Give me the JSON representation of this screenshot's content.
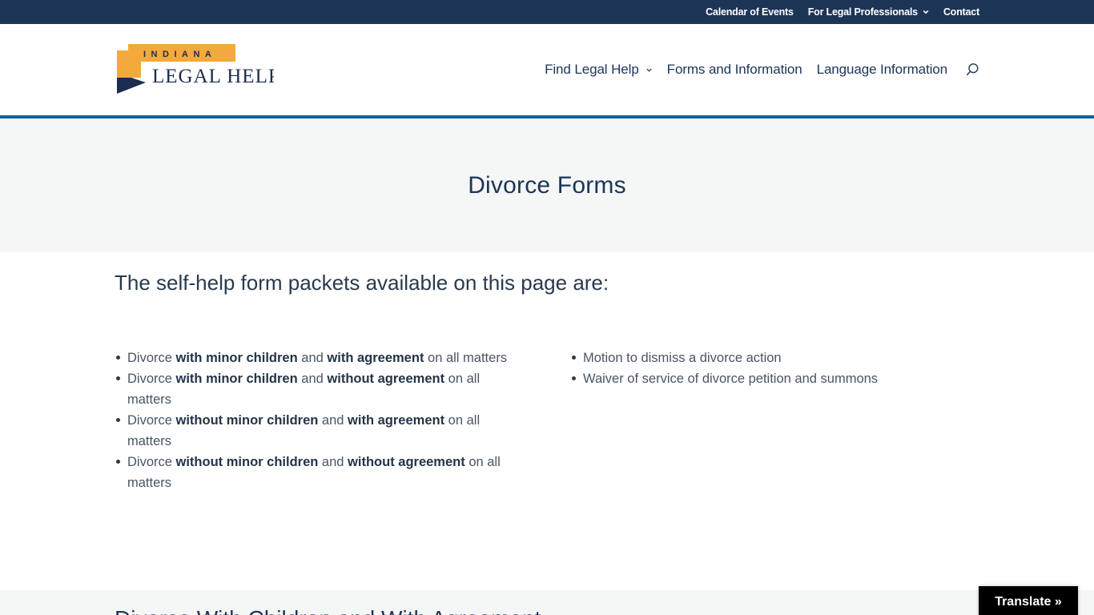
{
  "topbar": {
    "links": [
      {
        "label": "Calendar of Events",
        "has_dropdown": false
      },
      {
        "label": "For Legal Professionals",
        "has_dropdown": true
      },
      {
        "label": "Contact",
        "has_dropdown": false
      }
    ]
  },
  "logo": {
    "top_text": "INDIANA",
    "main_text": "LEGAL HELP",
    "colors": {
      "orange": "#f3a93c",
      "navy": "#1c2d4f"
    }
  },
  "nav": {
    "items": [
      {
        "label": "Find Legal Help",
        "has_dropdown": true
      },
      {
        "label": "Forms and Information",
        "has_dropdown": false
      },
      {
        "label": "Language Information",
        "has_dropdown": false
      }
    ],
    "search_icon": "search-icon"
  },
  "hero": {
    "title": "Divorce Forms"
  },
  "intro": {
    "title": "The self-help form packets available on this page are:"
  },
  "packets_left": [
    {
      "prefix": "Divorce ",
      "bold1": "with minor children",
      "mid": " and ",
      "bold2": "with agreement",
      "suffix": " on all matters"
    },
    {
      "prefix": "Divorce ",
      "bold1": "with minor children",
      "mid": " and ",
      "bold2": "without agreement",
      "suffix": " on all matters"
    },
    {
      "prefix": "Divorce ",
      "bold1": "without minor children",
      "mid": " and ",
      "bold2": "with agreement",
      "suffix": " on all matters"
    },
    {
      "prefix": "Divorce ",
      "bold1": "without minor children",
      "mid": " and ",
      "bold2": "without agreement",
      "suffix": " on all matters"
    }
  ],
  "packets_right": [
    "Motion to dismiss a divorce action",
    "Waiver of service of divorce petition and summons"
  ],
  "next_section": {
    "title": "Divorce With Children and With Agreement"
  },
  "translate": {
    "label": "Translate »"
  },
  "colors": {
    "topbar_bg": "#1c3557",
    "accent_bar": "#10619a",
    "hero_bg": "#f5f6f6",
    "text_dark": "#1c3557"
  }
}
